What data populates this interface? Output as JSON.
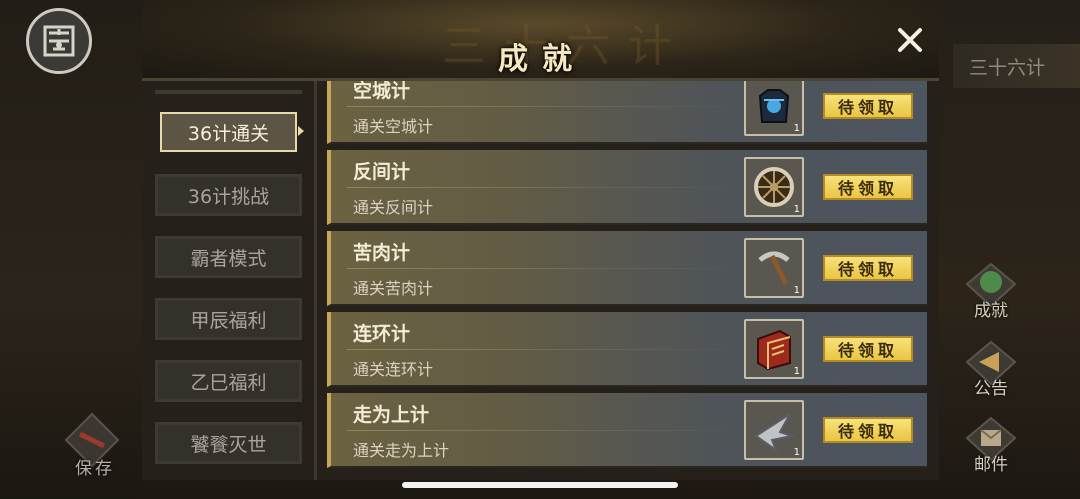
{
  "header": {
    "ghost_text": "三十六计",
    "title": "成就"
  },
  "categories": [
    {
      "label": "36计通关",
      "active": true
    },
    {
      "label": "36计挑战",
      "active": false
    },
    {
      "label": "霸者模式",
      "active": false
    },
    {
      "label": "甲辰福利",
      "active": false
    },
    {
      "label": "乙巳福利",
      "active": false
    },
    {
      "label": "饕餮灭世",
      "active": false
    }
  ],
  "achievements": [
    {
      "name": "空城计",
      "desc": "通关空城计",
      "reward_icon": "armor-icon",
      "reward_count": "1",
      "claim_label": "待领取"
    },
    {
      "name": "反间计",
      "desc": "通关反间计",
      "reward_icon": "wheel-icon",
      "reward_count": "1",
      "claim_label": "待领取"
    },
    {
      "name": "苦肉计",
      "desc": "通关苦肉计",
      "reward_icon": "pickaxe-icon",
      "reward_count": "1",
      "claim_label": "待领取"
    },
    {
      "name": "连环计",
      "desc": "通关连环计",
      "reward_icon": "book-icon",
      "reward_count": "1",
      "claim_label": "待领取"
    },
    {
      "name": "走为上计",
      "desc": "通关走为上计",
      "reward_icon": "wing-blade-icon",
      "reward_count": "1",
      "claim_label": "待领取"
    }
  ],
  "side": {
    "title": "三十六计",
    "achievements_label": "成就",
    "announcement_label": "公告",
    "mail_label": "邮件"
  },
  "save_label": "保存",
  "colors": {
    "accent_gold": "#c8a857",
    "claim_button": "#f1d45a"
  }
}
